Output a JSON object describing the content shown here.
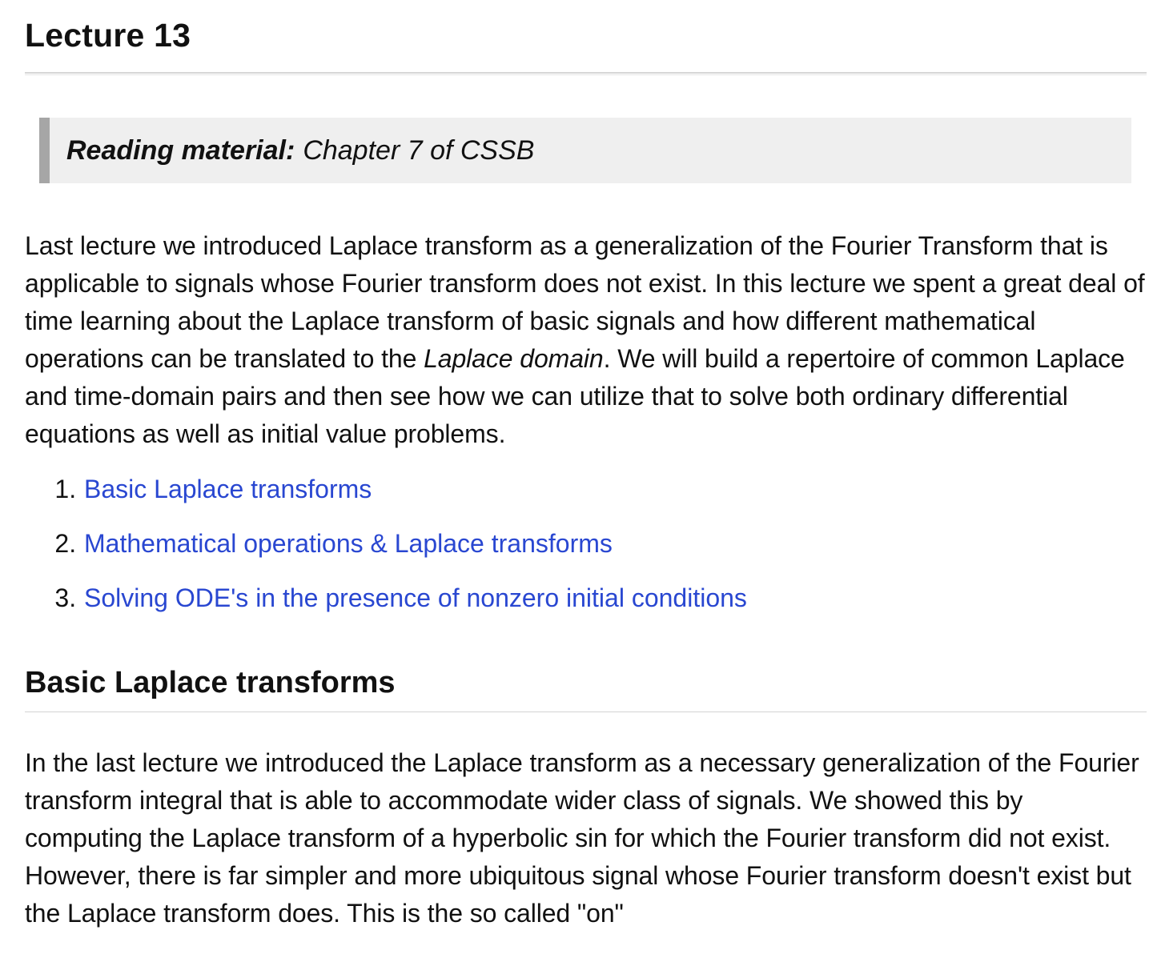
{
  "page": {
    "title": "Lecture 13"
  },
  "reading": {
    "label": "Reading material:",
    "text": "Chapter 7 of CSSB"
  },
  "intro": {
    "before_em": "Last lecture we introduced Laplace transform as a generalization of the Fourier Transform that is applicable to signals whose Fourier transform does not exist. In this lecture we spent a great deal of time learning about the Laplace transform of basic signals and how different mathematical operations can be translated to the ",
    "em": "Laplace domain",
    "after_em": ". We will build a repertoire of common Laplace and time-domain pairs and then see how we can utilize that to solve both ordinary differential equations as well as initial value problems."
  },
  "toc": {
    "items": [
      {
        "label": "Basic Laplace transforms"
      },
      {
        "label": "Mathematical operations & Laplace transforms"
      },
      {
        "label": "Solving ODE's in the presence of nonzero initial conditions"
      }
    ]
  },
  "section1": {
    "title": "Basic Laplace transforms",
    "body": "In the last lecture we introduced the Laplace transform as a necessary generalization of the Fourier transform integral that is able to accommodate wider class of signals. We showed this by computing the Laplace transform of a hyperbolic sin for which the Fourier transform did not exist. However, there is far simpler and more ubiquitous signal whose Fourier transform doesn't exist but the Laplace transform does. This is the so called \"on\""
  },
  "colors": {
    "link": "#2947d1",
    "text": "#111111",
    "quote_bg": "#efefef",
    "quote_border": "#a6a6a6"
  }
}
